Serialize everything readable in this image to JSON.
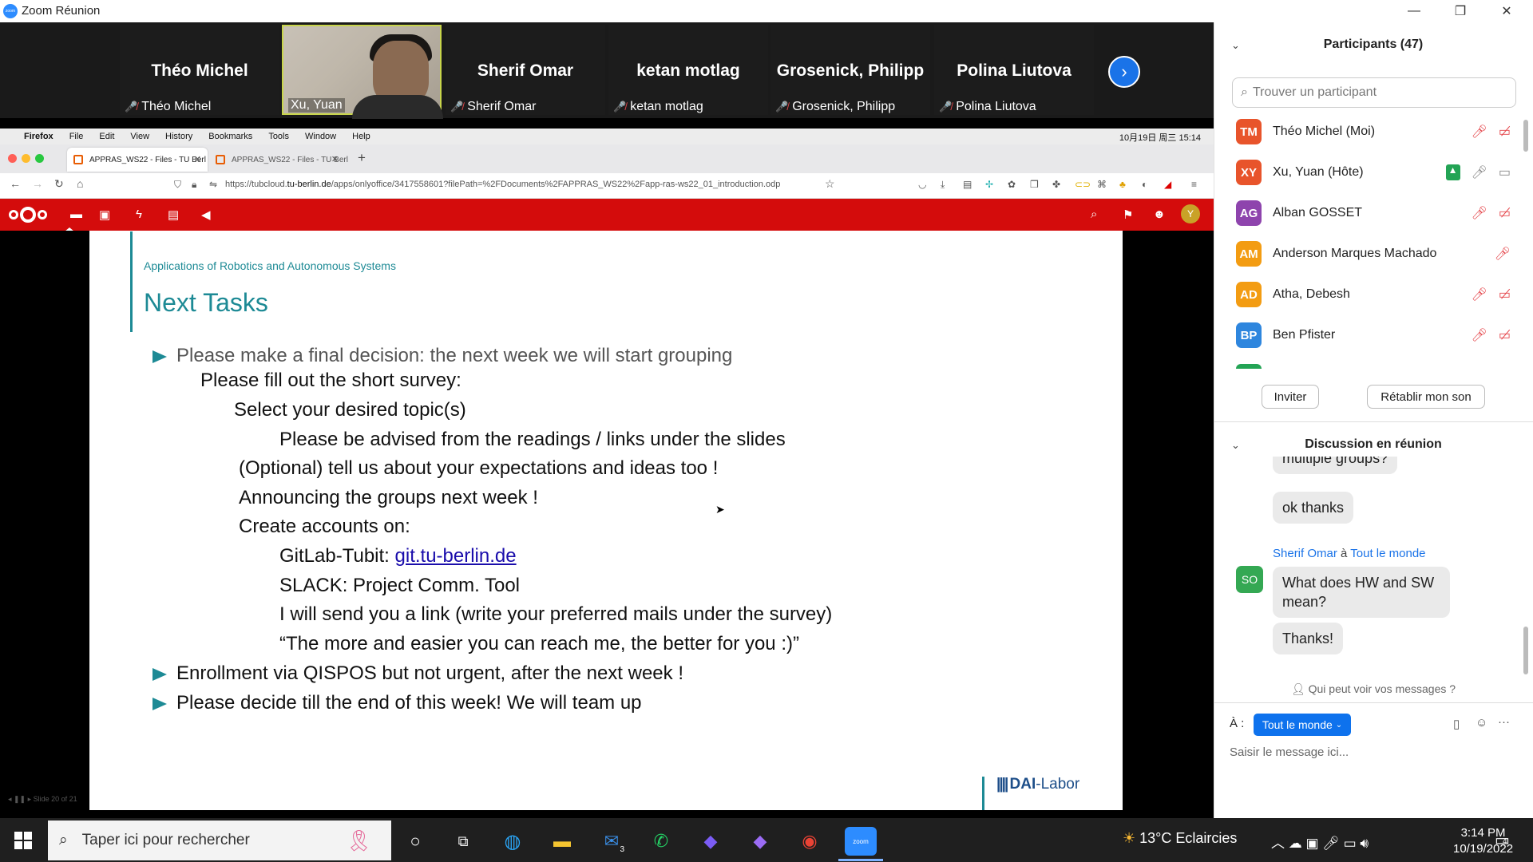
{
  "window": {
    "title": "Zoom Réunion",
    "zoom_logo": "zoom"
  },
  "video_strip": {
    "tiles": [
      {
        "display_name": "Théo Michel",
        "label": "Théo Michel",
        "muted": true
      },
      {
        "display_name": "",
        "label": "Xu, Yuan",
        "muted": false,
        "video_on": true
      },
      {
        "display_name": "Sherif Omar",
        "label": "Sherif Omar",
        "muted": true
      },
      {
        "display_name": "ketan motlag",
        "label": "ketan motlag",
        "muted": true
      },
      {
        "display_name": "Grosenick, Philipp",
        "label": "Grosenick, Philipp",
        "muted": true
      },
      {
        "display_name": "Polina Liutova",
        "label": "Polina Liutova",
        "muted": true
      }
    ]
  },
  "mac_menu": {
    "app": "Firefox",
    "items": [
      "File",
      "Edit",
      "View",
      "History",
      "Bookmarks",
      "Tools",
      "Window",
      "Help"
    ],
    "clock": "10月19日 周三 15:14"
  },
  "browser": {
    "tabs": [
      {
        "title": "APPRAS_WS22 - Files - TU Berl",
        "active": true
      },
      {
        "title": "APPRAS_WS22 - Files - TU Berl",
        "active": false
      }
    ],
    "new_tab": "+",
    "url_prefix": "https://tubcloud.",
    "url_host": "tu-berlin.de",
    "url_rest": "/apps/onlyoffice/3417558601?filePath=%2FDocuments%2FAPPRAS_WS22%2Fapp-ras-ws22_01_introduction.odp"
  },
  "nextcloud": {
    "avatar_letter": "Y",
    "brand_color": "#d40c0c"
  },
  "slide": {
    "subtitle": "Applications of Robotics and Autonomous Systems",
    "title": "Next Tasks",
    "bullet1": "Please make a final decision: the next week we will start grouping",
    "l1": "Please fill out the short survey:",
    "l2": "Select your desired topic(s)",
    "l3": "Please be advised from the readings / links under the slides",
    "l4": "(Optional) tell us about your expectations and ideas too !",
    "l5": "Announcing the groups next week !",
    "l6": "Create accounts on:",
    "l7_prefix": "GitLab-Tubit: ",
    "l7_link": "git.tu-berlin.de",
    "l8": "SLACK: Project Comm. Tool",
    "l9": "I will send you a link (write your preferred mails under the survey)",
    "l10": "“The more and easier you can reach me, the better for you :)”",
    "bullet2": "Enrollment via QISPOS but not urgent, after the next week !",
    "bullet3": "Please decide till the end of this week! We will team up",
    "footer_brand_a": "DAI",
    "footer_brand_b": "-Labor",
    "controls": "◂ ❚❚ ▸   Slide 20 of 21",
    "accent_color": "#1d8a95"
  },
  "participants": {
    "title": "Participants (47)",
    "search_placeholder": "Trouver un participant",
    "list": [
      {
        "initials": "TM",
        "name": "Théo Michel (Moi)",
        "color": "#e8542b",
        "mic": "muted",
        "cam": "off"
      },
      {
        "initials": "XY",
        "name": "Xu, Yuan (Hôte)",
        "color": "#e8542b",
        "mic": "on",
        "cam": "on",
        "sharing": true
      },
      {
        "initials": "AG",
        "name": "Alban GOSSET",
        "color": "#8e44ad",
        "mic": "muted",
        "cam": "off"
      },
      {
        "initials": "AM",
        "name": "Anderson Marques Machado",
        "color": "#f39c12",
        "mic": "muted",
        "cam": ""
      },
      {
        "initials": "AD",
        "name": "Atha, Debesh",
        "color": "#f39c12",
        "mic": "muted",
        "cam": "off"
      },
      {
        "initials": "BP",
        "name": "Ben Pfister",
        "color": "#2e86de",
        "mic": "muted",
        "cam": "off"
      }
    ],
    "invite_label": "Inviter",
    "unmute_label": "Rétablir mon son"
  },
  "chat": {
    "title": "Discussion en réunion",
    "messages_prev": [
      "multiple groups?",
      "ok thanks"
    ],
    "sender": "Sherif Omar",
    "sender_sep": "à",
    "recipient": "Tout le monde",
    "sender_initials": "SO",
    "messages": [
      "What does HW and SW mean?",
      "Thanks!"
    ],
    "who_can_see": "Qui peut voir vos messages ?",
    "to_label": "À :",
    "to_value": "Tout le monde",
    "input_placeholder": "Saisir le message ici...",
    "more": "···"
  },
  "taskbar": {
    "search_placeholder": "Taper ici pour rechercher",
    "weather": "13°C  Eclaircies",
    "time": "3:14 PM",
    "date": "10/19/2022",
    "mail_badge": "3",
    "notif_badge": "4"
  }
}
